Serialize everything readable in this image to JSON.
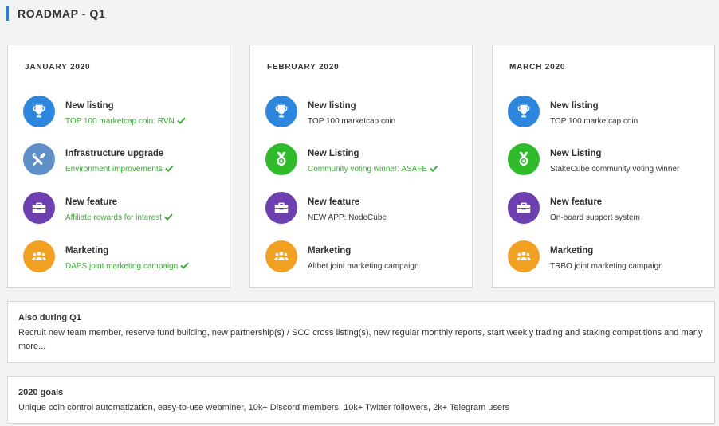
{
  "page": {
    "title": "ROADMAP - Q1"
  },
  "colors": {
    "accent": "#2d7fd6",
    "done": "#3aaa35",
    "listing": "#2d86dd",
    "infrastructure": "#5f8fc8",
    "community": "#2fbb2b",
    "feature": "#6e3fae",
    "marketing": "#f2a021"
  },
  "months": [
    {
      "title": "JANUARY 2020",
      "items": [
        {
          "icon": "trophy-icon",
          "color": "blue",
          "title": "New listing",
          "subtitle": "TOP 100 marketcap coin: RVN",
          "done": true
        },
        {
          "icon": "tools-icon",
          "color": "steel",
          "title": "Infrastructure upgrade",
          "subtitle": "Environment improvements",
          "done": true
        },
        {
          "icon": "toolbox-icon",
          "color": "purple",
          "title": "New feature",
          "subtitle": "Affiliate rewards for interest",
          "done": true
        },
        {
          "icon": "group-icon",
          "color": "orange",
          "title": "Marketing",
          "subtitle": "DAPS joint marketing campaign",
          "done": true
        }
      ]
    },
    {
      "title": "FEBRUARY 2020",
      "items": [
        {
          "icon": "trophy-icon",
          "color": "blue",
          "title": "New listing",
          "subtitle": "TOP 100 marketcap coin",
          "done": false
        },
        {
          "icon": "medal-icon",
          "color": "green",
          "title": "New Listing",
          "subtitle": "Community voting winner: ASAFE",
          "done": true
        },
        {
          "icon": "toolbox-icon",
          "color": "purple",
          "title": "New feature",
          "subtitle": "NEW APP: NodeCube",
          "done": false
        },
        {
          "icon": "group-icon",
          "color": "orange",
          "title": "Marketing",
          "subtitle": "Altbet joint marketing campaign",
          "done": false
        }
      ]
    },
    {
      "title": "MARCH 2020",
      "items": [
        {
          "icon": "trophy-icon",
          "color": "blue",
          "title": "New listing",
          "subtitle": "TOP 100 marketcap coin",
          "done": false
        },
        {
          "icon": "medal-icon",
          "color": "green",
          "title": "New Listing",
          "subtitle": "StakeCube community voting winner",
          "done": false
        },
        {
          "icon": "toolbox-icon",
          "color": "purple",
          "title": "New feature",
          "subtitle": "On-board support system",
          "done": false
        },
        {
          "icon": "group-icon",
          "color": "orange",
          "title": "Marketing",
          "subtitle": "TRBO joint marketing campaign",
          "done": false
        }
      ]
    }
  ],
  "also": {
    "title": "Also during Q1",
    "text": "Recruit new team member, reserve fund building, new partnership(s) / SCC cross listing(s), new regular monthly reports, start weekly trading and staking competitions and many more..."
  },
  "goals": {
    "title": "2020 goals",
    "text": "Unique coin control automatization, easy-to-use webminer, 10k+ Discord members, 10k+ Twitter followers, 2k+ Telegram users"
  }
}
